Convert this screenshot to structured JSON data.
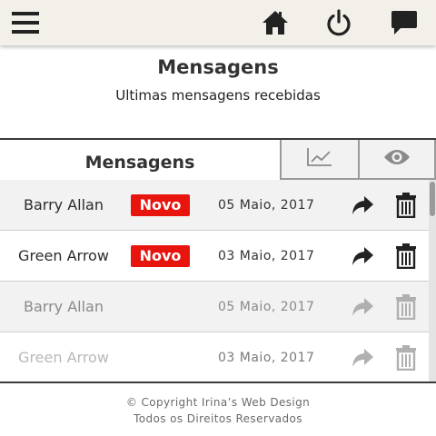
{
  "topbar": {
    "icons": [
      "menu-icon",
      "home-icon",
      "power-icon",
      "chat-icon"
    ]
  },
  "page": {
    "title": "Mensagens",
    "subtitle": "Ultimas mensagens recebidas"
  },
  "panel": {
    "title": "Mensagens",
    "header_icons": [
      "chart-icon",
      "eye-icon"
    ],
    "messages": [
      {
        "name": "Barry Allan",
        "badge": "Novo",
        "date": "05 Maio, 2017",
        "read": false
      },
      {
        "name": "Green Arrow",
        "badge": "Novo",
        "date": "03 Maio, 2017",
        "read": false
      },
      {
        "name": "Barry Allan",
        "badge": "",
        "date": "05 Maio, 2017",
        "read": true
      },
      {
        "name": "Green Arrow",
        "badge": "",
        "date": "03 Maio, 2017",
        "read": true
      }
    ]
  },
  "footer": {
    "line1": "© Copyright Irina’s Web Design",
    "line2": "Todos os Direitos Reservados"
  },
  "colors": {
    "topbar_bg": "#f3f0ea",
    "badge_red": "#e8150f",
    "row_alt_bg": "#f2f2f2",
    "icon_dark": "#222222",
    "icon_faded": "#b0b0b0"
  }
}
